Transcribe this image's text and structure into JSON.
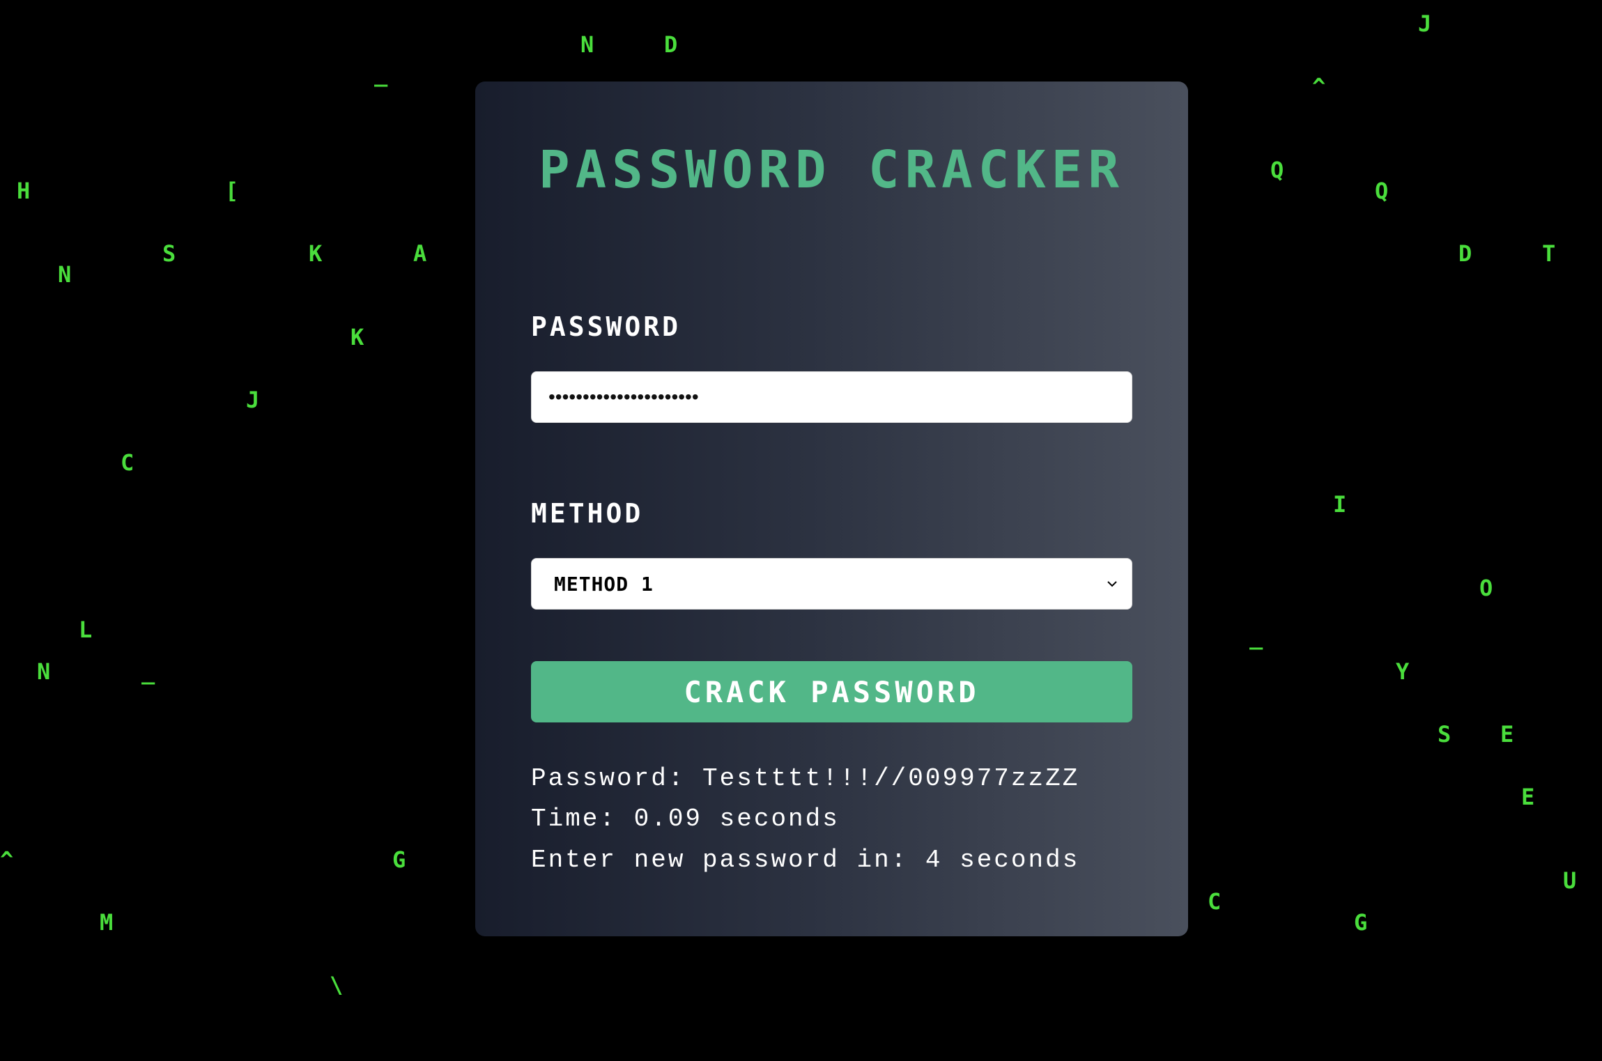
{
  "app": {
    "title": "PASSWORD CRACKER"
  },
  "form": {
    "password_label": "PASSWORD",
    "password_value": "••••••••••••••••••••••",
    "method_label": "METHOD",
    "method_selected": "METHOD 1",
    "submit_label": "CRACK PASSWORD"
  },
  "result": {
    "password_line": "Password: Testttt!!!//009977zzZZ",
    "time_line": "Time: 0.09 seconds",
    "countdown_line": "Enter new password in: 4 seconds"
  },
  "background": {
    "falling_chars": [
      "N",
      "D",
      "J",
      "_",
      "^",
      "H",
      "[",
      "Q",
      "Q",
      "S",
      "K",
      "A",
      "N",
      "D",
      "T",
      "K",
      "J",
      "C",
      "I",
      "O",
      "L",
      "_",
      "N",
      "_",
      "Y",
      "S",
      "E",
      "E",
      "^",
      "G",
      "U",
      "C",
      "G",
      "M",
      "\\"
    ]
  },
  "colors": {
    "background": "#000000",
    "matrix_green": "#4ade3c",
    "accent_green": "#52b788",
    "text_white": "#ffffff"
  },
  "icons": {
    "select_arrow": "chevron-down-icon"
  }
}
